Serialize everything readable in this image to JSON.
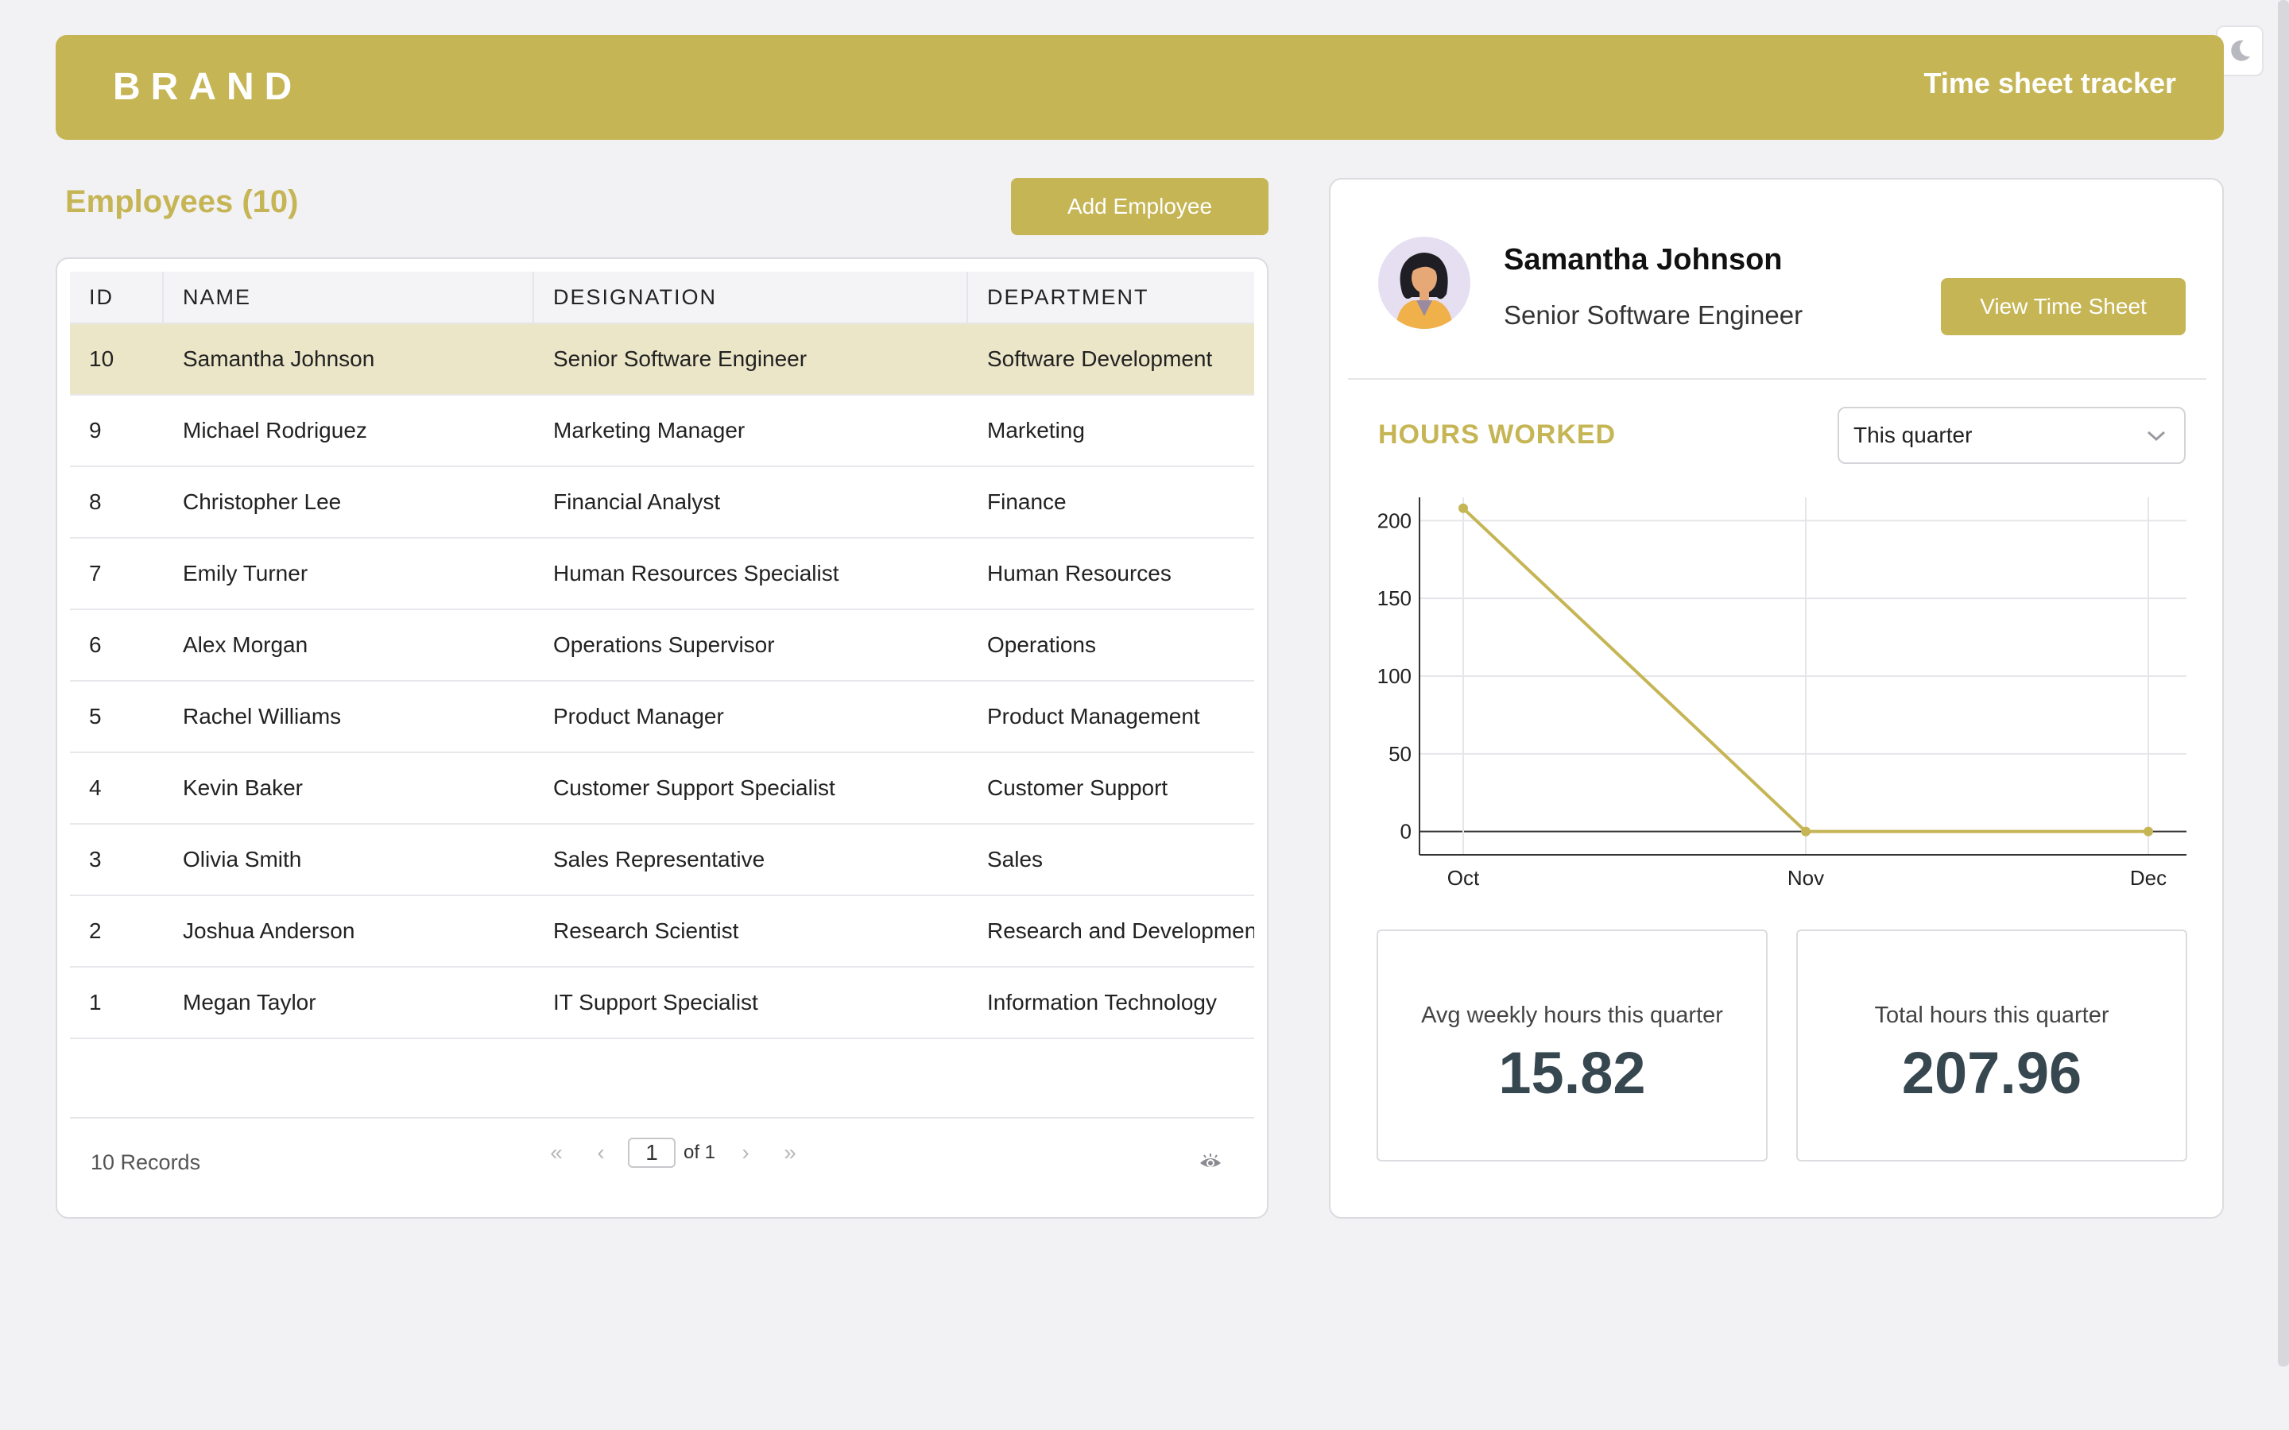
{
  "header": {
    "brand": "BRAND",
    "title": "Time sheet tracker"
  },
  "employees": {
    "title": "Employees (10)",
    "add_button": "Add Employee",
    "columns": [
      "ID",
      "NAME",
      "DESIGNATION",
      "DEPARTMENT"
    ],
    "rows": [
      {
        "id": "10",
        "name": "Samantha Johnson",
        "designation": "Senior Software Engineer",
        "department": "Software Development"
      },
      {
        "id": "9",
        "name": "Michael Rodriguez",
        "designation": "Marketing Manager",
        "department": "Marketing"
      },
      {
        "id": "8",
        "name": "Christopher Lee",
        "designation": "Financial Analyst",
        "department": "Finance"
      },
      {
        "id": "7",
        "name": "Emily Turner",
        "designation": "Human Resources Specialist",
        "department": "Human Resources"
      },
      {
        "id": "6",
        "name": "Alex Morgan",
        "designation": "Operations Supervisor",
        "department": "Operations"
      },
      {
        "id": "5",
        "name": "Rachel Williams",
        "designation": "Product Manager",
        "department": "Product Management"
      },
      {
        "id": "4",
        "name": "Kevin Baker",
        "designation": "Customer Support Specialist",
        "department": "Customer Support"
      },
      {
        "id": "3",
        "name": "Olivia Smith",
        "designation": "Sales Representative",
        "department": "Sales"
      },
      {
        "id": "2",
        "name": "Joshua Anderson",
        "designation": "Research Scientist",
        "department": "Research and Developmen"
      },
      {
        "id": "1",
        "name": "Megan Taylor",
        "designation": "IT Support Specialist",
        "department": "Information Technology"
      }
    ],
    "selected_index": 0,
    "records_label": "10 Records",
    "pagination": {
      "first": "«",
      "prev": "‹",
      "page": "1",
      "of_label": "of 1",
      "next": "›",
      "last": "»"
    }
  },
  "detail": {
    "name": "Samantha Johnson",
    "role": "Senior Software Engineer",
    "view_button": "View Time Sheet",
    "hours_title": "HOURS WORKED",
    "period_select": "This quarter",
    "stats": [
      {
        "label": "Avg weekly hours this quarter",
        "value": "15.82"
      },
      {
        "label": "Total hours this quarter",
        "value": "207.96"
      }
    ]
  },
  "icons": {
    "theme_toggle": "moon-icon",
    "select_chevron": "chevron-down-icon",
    "column_visibility": "eye-icon"
  },
  "colors": {
    "accent": "#c5b555",
    "selected_row": "#ebe6c8",
    "stat_value": "#37474f"
  },
  "chart_data": {
    "type": "line",
    "categories": [
      "Oct",
      "Nov",
      "Dec"
    ],
    "series": [
      {
        "values": [
          207.96,
          0,
          0
        ]
      }
    ],
    "ylim": [
      -15,
      215
    ],
    "yticks": [
      0,
      50,
      100,
      150,
      200
    ],
    "grid": true,
    "color": "#c5b555"
  }
}
